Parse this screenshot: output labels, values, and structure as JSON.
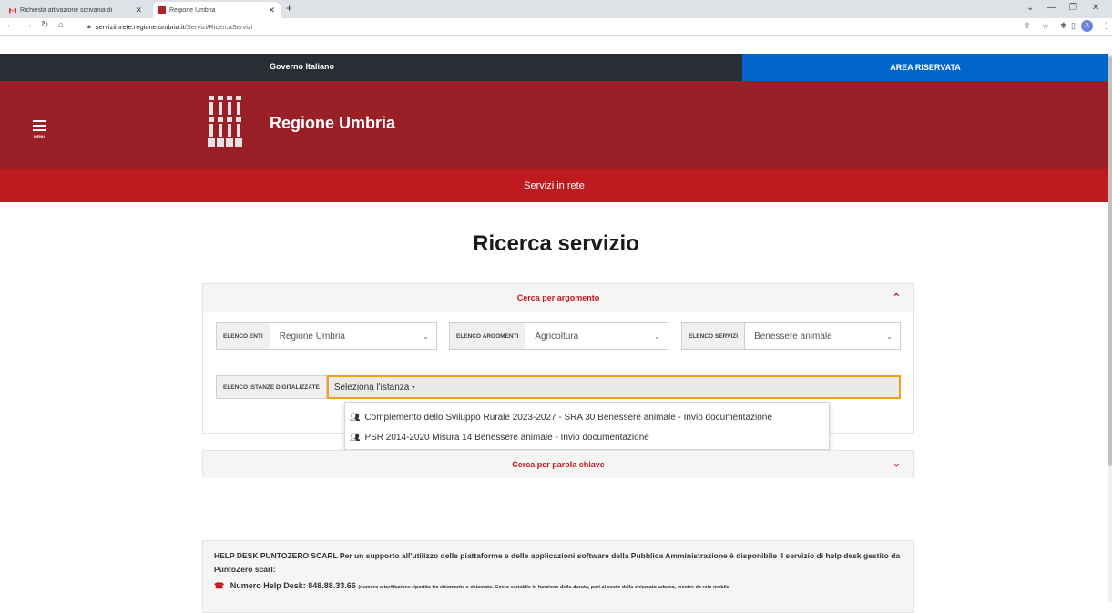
{
  "browser": {
    "tabs": [
      {
        "title": "Richiesta attivazione scrivania di",
        "favicon": "gmail-icon",
        "active": false
      },
      {
        "title": "Regione Umbria",
        "favicon": "regione-favicon",
        "active": true
      }
    ],
    "new_tab": "+",
    "address": {
      "domain": "serviziinrete.regione.umbria.it",
      "path": "/Servizi/RicercaServizi"
    },
    "avatar_letter": "A"
  },
  "header": {
    "gov_label": "Governo Italiano",
    "area_label": "AREA RISERVATA",
    "menu_label": "MENU",
    "brand_name": "Regione Umbria",
    "subbar_label": "Servizi in rete",
    "colors": {
      "gov": "#2a2d33",
      "area": "#0066cc",
      "brand": "#9a2028",
      "subbar": "#bf1a1f"
    }
  },
  "page": {
    "title": "Ricerca servizio"
  },
  "search_by_topic": {
    "heading": "Cerca per argomento",
    "expanded": true,
    "filters": [
      {
        "label": "ELENCO ENTI",
        "value": "Regione Umbria"
      },
      {
        "label": "ELENCO ARGOMENTI",
        "value": "Agricoltura"
      },
      {
        "label": "ELENCO SERVIZI",
        "value": "Benessere animale"
      }
    ],
    "istanze": {
      "label": "ELENCO ISTANZE DIGITALIZZATE",
      "placeholder": "Seleziona l'istanza",
      "options": [
        "Complemento dello Sviluppo Rurale 2023-2027 - SRA 30 Benessere animale - Invio documentazione",
        "PSR 2014-2020 Misura 14 Benessere animale - Invio documentazione"
      ]
    }
  },
  "search_by_keyword": {
    "heading": "Cerca per parola chiave",
    "expanded": false
  },
  "helpdesk": {
    "text": "HELP DESK PUNTOZERO SCARL Per un supporto all'utilizzo delle piattaforme e delle applicazioni software della Pubblica Amministrazione è disponibile il servizio di help desk gestito da PuntoZero scarl:",
    "number_label": "Numero Help Desk: 848.88.33.66",
    "number_note": "(numero a tariffazione ripartita tra chiamante e chiamato. Costo variabile in funzione della durata, pari al costo della chiamata urbana, mentre da rete mobile"
  }
}
